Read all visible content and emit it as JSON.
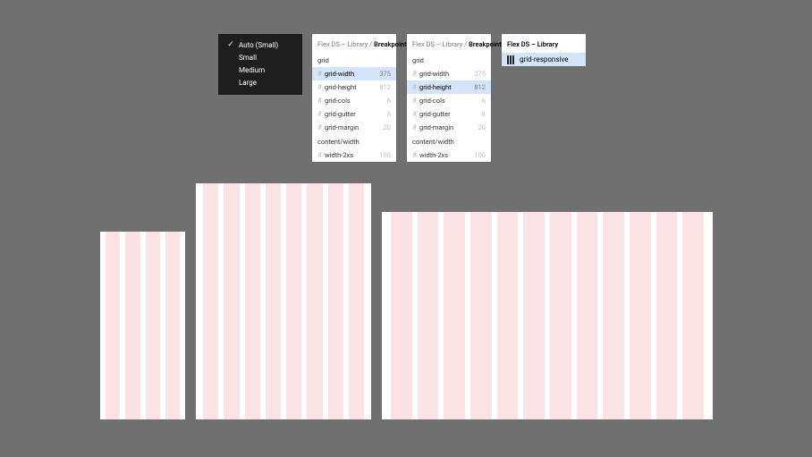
{
  "dropdown": {
    "items": [
      {
        "label": "Auto (Small)",
        "checked": true
      },
      {
        "label": "Small",
        "checked": false
      },
      {
        "label": "Medium",
        "checked": false
      },
      {
        "label": "Large",
        "checked": false
      }
    ]
  },
  "panel1": {
    "crumb_prefix": "Flex DS – Library / ",
    "crumb_current": "Breakpoint",
    "sections": [
      {
        "label": "grid",
        "rows": [
          {
            "name": "grid-width",
            "value": "375",
            "selected": true
          },
          {
            "name": "grid-height",
            "value": "812",
            "selected": false
          },
          {
            "name": "grid-cols",
            "value": "6",
            "selected": false
          },
          {
            "name": "grid-gutter",
            "value": "8",
            "selected": false
          },
          {
            "name": "grid-margin",
            "value": "20",
            "selected": false
          }
        ]
      },
      {
        "label": "content/width",
        "rows": [
          {
            "name": "width-2xs",
            "value": "106",
            "selected": false
          }
        ]
      }
    ]
  },
  "panel2": {
    "crumb_prefix": "Flex DS – Library / ",
    "crumb_current": "Breakpoint",
    "sections": [
      {
        "label": "grid",
        "rows": [
          {
            "name": "grid-width",
            "value": "375",
            "selected": false
          },
          {
            "name": "grid-height",
            "value": "812",
            "selected": true
          },
          {
            "name": "grid-cols",
            "value": "6",
            "selected": false
          },
          {
            "name": "grid-gutter",
            "value": "8",
            "selected": false
          },
          {
            "name": "grid-margin",
            "value": "20",
            "selected": false
          }
        ]
      },
      {
        "label": "content/width",
        "rows": [
          {
            "name": "width-2xs",
            "value": "106",
            "selected": false
          }
        ]
      }
    ]
  },
  "panel3": {
    "crumb_prefix": "",
    "crumb_current": "Flex DS – Library",
    "rows": [
      {
        "name": "grid-responsive",
        "selected": true
      }
    ]
  },
  "boards": {
    "small_cols": 4,
    "medium_cols": 8,
    "large_cols": 12
  }
}
